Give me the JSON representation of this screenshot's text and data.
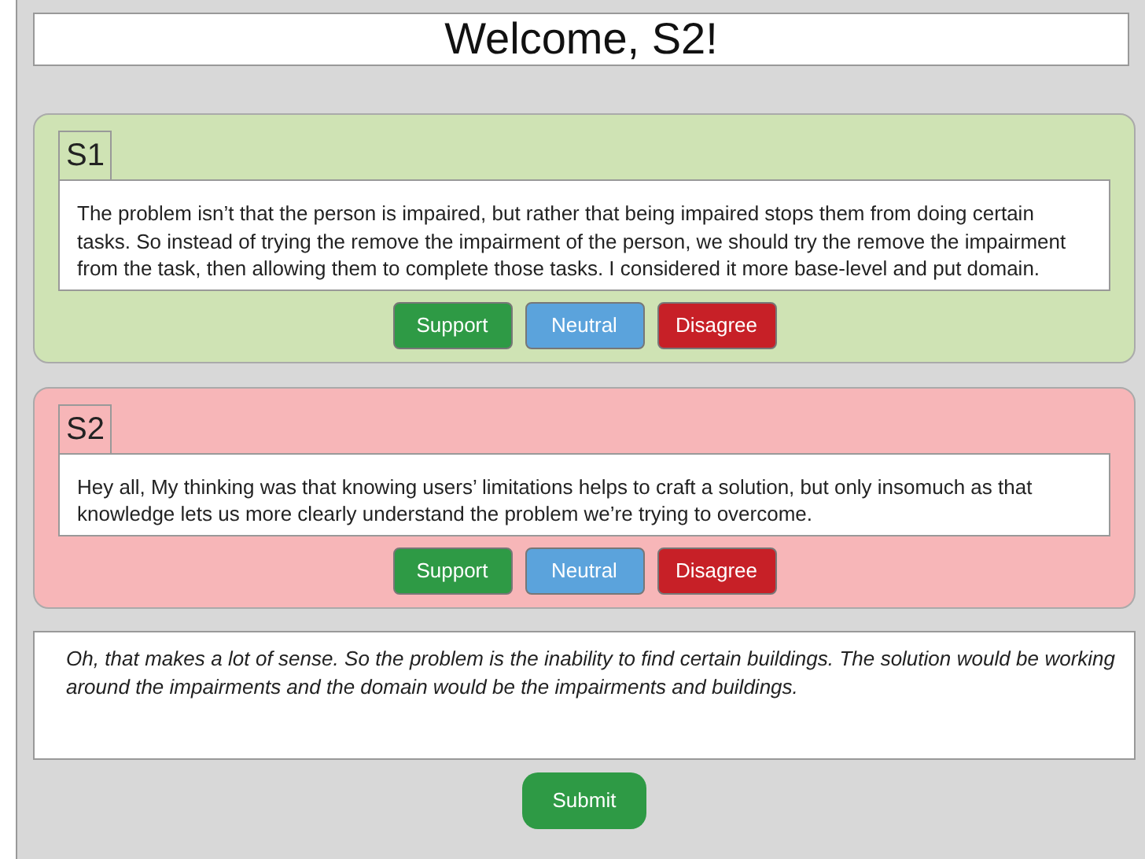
{
  "title": "Welcome, S2!",
  "posts": [
    {
      "author": "S1",
      "color": "#cfe3b4",
      "text": "The problem isn’t that the person is impaired, but rather that being impaired stops them from doing certain tasks. So instead of trying the remove the impairment of the person, we should try the remove the impairment from the task, then allowing them to complete those tasks. I considered it more base-level and put domain.",
      "buttons": [
        {
          "kind": "support",
          "label": "Support"
        },
        {
          "kind": "neutral",
          "label": "Neutral"
        },
        {
          "kind": "disagree",
          "label": "Disagree"
        }
      ]
    },
    {
      "author": "S2",
      "color": "#f7b6b8",
      "text": "Hey all, My thinking was that knowing users’ limitations helps to craft a solution, but only insomuch as that knowledge lets us more clearly understand the problem we’re trying to overcome.",
      "buttons": [
        {
          "kind": "support",
          "label": "Support"
        },
        {
          "kind": "neutral",
          "label": "Neutral"
        },
        {
          "kind": "disagree",
          "label": "Disagree"
        }
      ]
    }
  ],
  "response": {
    "value": "Oh, that makes a lot of sense. So the problem is the inability to find certain buildings. The solution would be working around the impairments and the domain would be the impairments and buildings."
  },
  "submit": "Submit"
}
